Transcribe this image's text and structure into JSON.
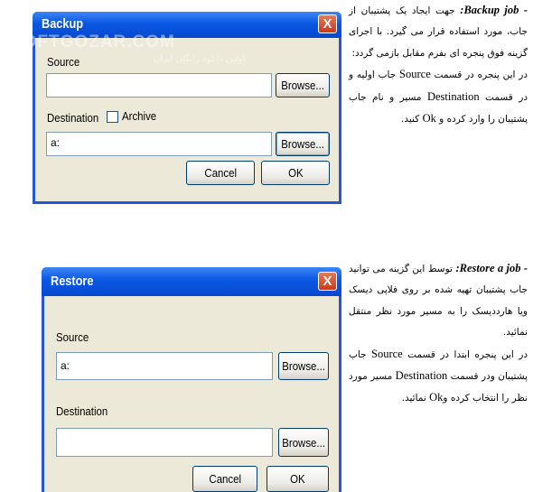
{
  "backup_dialog": {
    "title": "Backup",
    "close_glyph": "X",
    "source_label": "Source",
    "source_value": "",
    "browse_label": "Browse...",
    "destination_label": "Destination",
    "archive_label": "Archive",
    "archive_checked": false,
    "destination_value": "a:",
    "cancel_label": "Cancel",
    "ok_label": "OK"
  },
  "restore_dialog": {
    "title": "Restore",
    "close_glyph": "X",
    "source_label": "Source",
    "source_value": "a:",
    "browse_label": "Browse...",
    "destination_label": "Destination",
    "destination_value": "",
    "cancel_label": "Cancel",
    "ok_label": "OK"
  },
  "watermark": {
    "text": "SOFTGOZAR.COM",
    "subtext": "اولین دانلود رایگان ایران"
  },
  "backup_text": {
    "heading": "- Backup job:",
    "body1": " جهت ایجاد یک پشتیبان از جاب، مورد استفاده قرار می گیرد. با اجرای گزینه فوق پنجره ای بفرم مقابل بازمی گردد:",
    "body2a": "در این پنجره در قسمت ",
    "source_word": "Source",
    "body2b": " جاب اولیه و در قسمت ",
    "destination_word": "Destination",
    "body2c": " مسیر و نام جاب پشتیبان را وارد کرده و ",
    "ok_word": "Ok",
    "body2d": " کنید."
  },
  "restore_text": {
    "heading": "- Restore a job:",
    "body1": " توسط این گزینه می توانید جاب پشتیبان تهیه شده بر روی فلاپی دیسک ویا هارددیسک را به مسیر مورد نظر منتقل نمائید.",
    "body2a": "در این پنجره ابتدا در قسمت ",
    "source_word": "Source",
    "body2b": " جاب پشتیبان ودر قسمت ",
    "destination_word": "Destination",
    "body2c": " مسیر مورد نظر را انتخاب کرده و",
    "ok_word": "Ok",
    "body2d": " نمائید."
  }
}
